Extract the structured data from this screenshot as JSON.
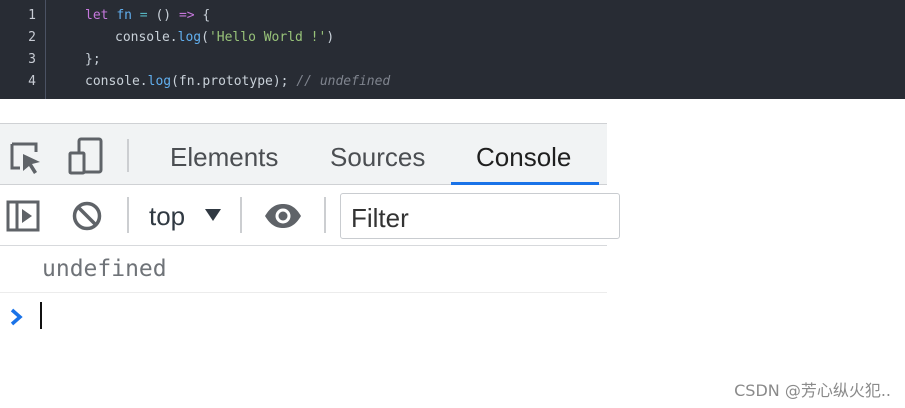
{
  "code": {
    "line_numbers": [
      "1",
      "2",
      "3",
      "4"
    ],
    "lines": [
      [
        {
          "t": "let ",
          "c": "kw"
        },
        {
          "t": "fn",
          "c": "fn"
        },
        {
          "t": " = ",
          "c": "op"
        },
        {
          "t": "() ",
          "c": "pn"
        },
        {
          "t": "=>",
          "c": "kw"
        },
        {
          "t": " {",
          "c": "pn"
        }
      ],
      [
        {
          "t": "console.",
          "c": "pn"
        },
        {
          "t": "log",
          "c": "fn"
        },
        {
          "t": "(",
          "c": "pn"
        },
        {
          "t": "'Hello World !'",
          "c": "st"
        },
        {
          "t": ")",
          "c": "pn"
        }
      ],
      [
        {
          "t": "};",
          "c": "pn"
        }
      ],
      [
        {
          "t": "console.",
          "c": "pn"
        },
        {
          "t": "log",
          "c": "fn"
        },
        {
          "t": "(fn.prototype); ",
          "c": "pn"
        },
        {
          "t": "// undefined",
          "c": "cm"
        }
      ]
    ]
  },
  "devtools": {
    "tabs": [
      "Elements",
      "Sources",
      "Console"
    ],
    "active_tab": "Console",
    "context_selector": "top",
    "filter_placeholder": "Filter",
    "console_output": "undefined"
  },
  "icons": {
    "inspect": "inspect-element-icon",
    "device": "device-toolbar-icon",
    "sidebar": "show-sidebar-icon",
    "clear": "clear-console-icon",
    "eye": "live-expression-eye-icon",
    "prompt": "prompt-chevron-icon"
  },
  "colors": {
    "code_bg": "#282c34",
    "keyword": "#c678dd",
    "function": "#61afef",
    "string": "#98c379",
    "comment": "#7f848e",
    "accent": "#1a73e8"
  },
  "watermark": "CSDN @芳心纵火犯.."
}
